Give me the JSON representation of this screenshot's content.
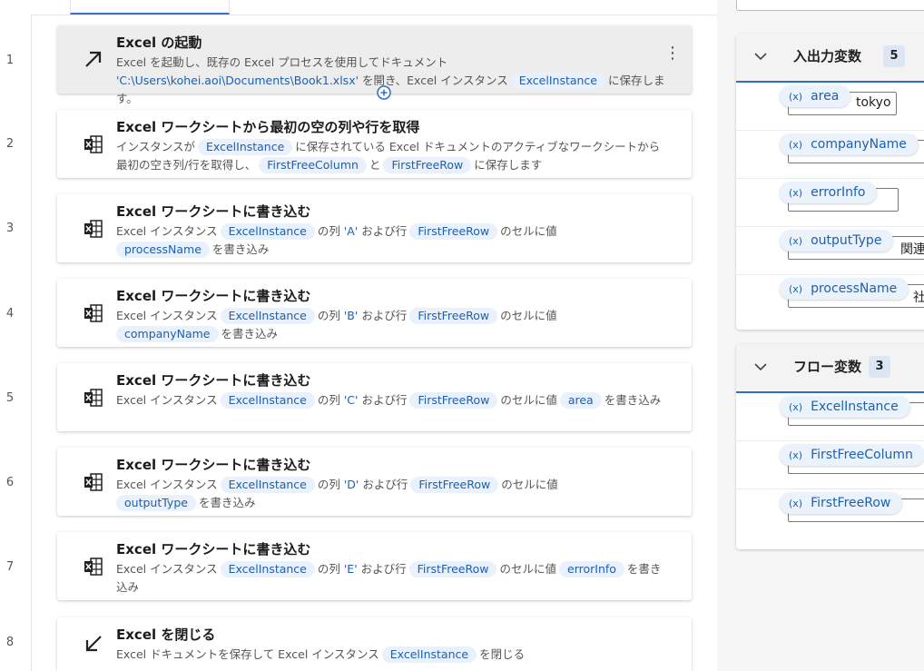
{
  "steps": [
    {
      "num": "1",
      "title": "Excel の起動",
      "desc_a": "Excel を起動し、既存の Excel プロセスを使用してドキュメント ",
      "desc_lit1": "'C:\\Users\\kohei.aoi\\Documents\\Book1.xlsx'",
      "desc_b": " を開き、Excel インスタンス",
      "tok1": "ExcelInstance",
      "desc_c": "に保存します。",
      "icon": "launch-arrow-icon"
    },
    {
      "num": "2",
      "title": "Excel ワークシートから最初の空の列や行を取得",
      "desc_a": "インスタンスが",
      "tok1": "ExcelInstance",
      "desc_b": "に保存されている Excel ドキュメントのアクティブなワークシートから最初の空き列/行を取得し、",
      "tok2": "FirstFreeColumn",
      "desc_c": "と",
      "tok3": "FirstFreeRow",
      "desc_d": "に保存します",
      "icon": "excel-sheet-icon"
    },
    {
      "num": "3",
      "title": "Excel ワークシートに書き込む",
      "desc_a": "Excel インスタンス",
      "tok1": "ExcelInstance",
      "desc_b": "の列",
      "lit": "'A'",
      "desc_c": "および行",
      "tok2": "FirstFreeRow",
      "desc_d": "のセルに値",
      "tok3": "processName",
      "desc_e": "を書き込み",
      "icon": "excel-sheet-icon"
    },
    {
      "num": "4",
      "title": "Excel ワークシートに書き込む",
      "desc_a": "Excel インスタンス",
      "tok1": "ExcelInstance",
      "desc_b": "の列",
      "lit": "'B'",
      "desc_c": "および行",
      "tok2": "FirstFreeRow",
      "desc_d": "のセルに値",
      "tok3": "companyName",
      "desc_e": "を書き込み",
      "icon": "excel-sheet-icon"
    },
    {
      "num": "5",
      "title": "Excel ワークシートに書き込む",
      "desc_a": "Excel インスタンス",
      "tok1": "ExcelInstance",
      "desc_b": "の列",
      "lit": "'C'",
      "desc_c": "および行",
      "tok2": "FirstFreeRow",
      "desc_d": "のセルに値",
      "tok3": "area",
      "desc_e": "を書き込み",
      "icon": "excel-sheet-icon"
    },
    {
      "num": "6",
      "title": "Excel ワークシートに書き込む",
      "desc_a": "Excel インスタンス",
      "tok1": "ExcelInstance",
      "desc_b": "の列",
      "lit": "'D'",
      "desc_c": "および行",
      "tok2": "FirstFreeRow",
      "desc_d": "のセルに値",
      "tok3": "outputType",
      "desc_e": "を書き込み",
      "icon": "excel-sheet-icon"
    },
    {
      "num": "7",
      "title": "Excel ワークシートに書き込む",
      "desc_a": "Excel インスタンス",
      "tok1": "ExcelInstance",
      "desc_b": "の列",
      "lit": "'E'",
      "desc_c": "および行",
      "tok2": "FirstFreeRow",
      "desc_d": "のセルに値",
      "tok3": "errorInfo",
      "desc_e": "を書き込み",
      "icon": "excel-sheet-icon"
    },
    {
      "num": "8",
      "title": "Excel を閉じる",
      "desc_a": "Excel ドキュメントを保存して Excel インスタンス",
      "tok1": "ExcelInstance",
      "desc_b": "を閉じる",
      "icon": "close-arrow-icon"
    }
  ],
  "io_vars": {
    "title": "入出力変数",
    "count": "5",
    "items": [
      {
        "prefix": "(x)",
        "name": "area",
        "value": "tokyo"
      },
      {
        "prefix": "(x)",
        "name": "companyName",
        "value": ""
      },
      {
        "prefix": "(x)",
        "name": "errorInfo",
        "value": ""
      },
      {
        "prefix": "(x)",
        "name": "outputType",
        "value": "関連"
      },
      {
        "prefix": "(x)",
        "name": "processName",
        "value": "社"
      }
    ]
  },
  "flow_vars": {
    "title": "フロー変数",
    "count": "3",
    "items": [
      {
        "prefix": "(x)",
        "name": "ExcelInstance"
      },
      {
        "prefix": "(x)",
        "name": "FirstFreeColumn"
      },
      {
        "prefix": "(x)",
        "name": "FirstFreeRow"
      }
    ]
  },
  "colors": {
    "accent": "#2d6dcc",
    "token_bg": "#e8f1fc",
    "token_fg": "#1f5fb0"
  }
}
